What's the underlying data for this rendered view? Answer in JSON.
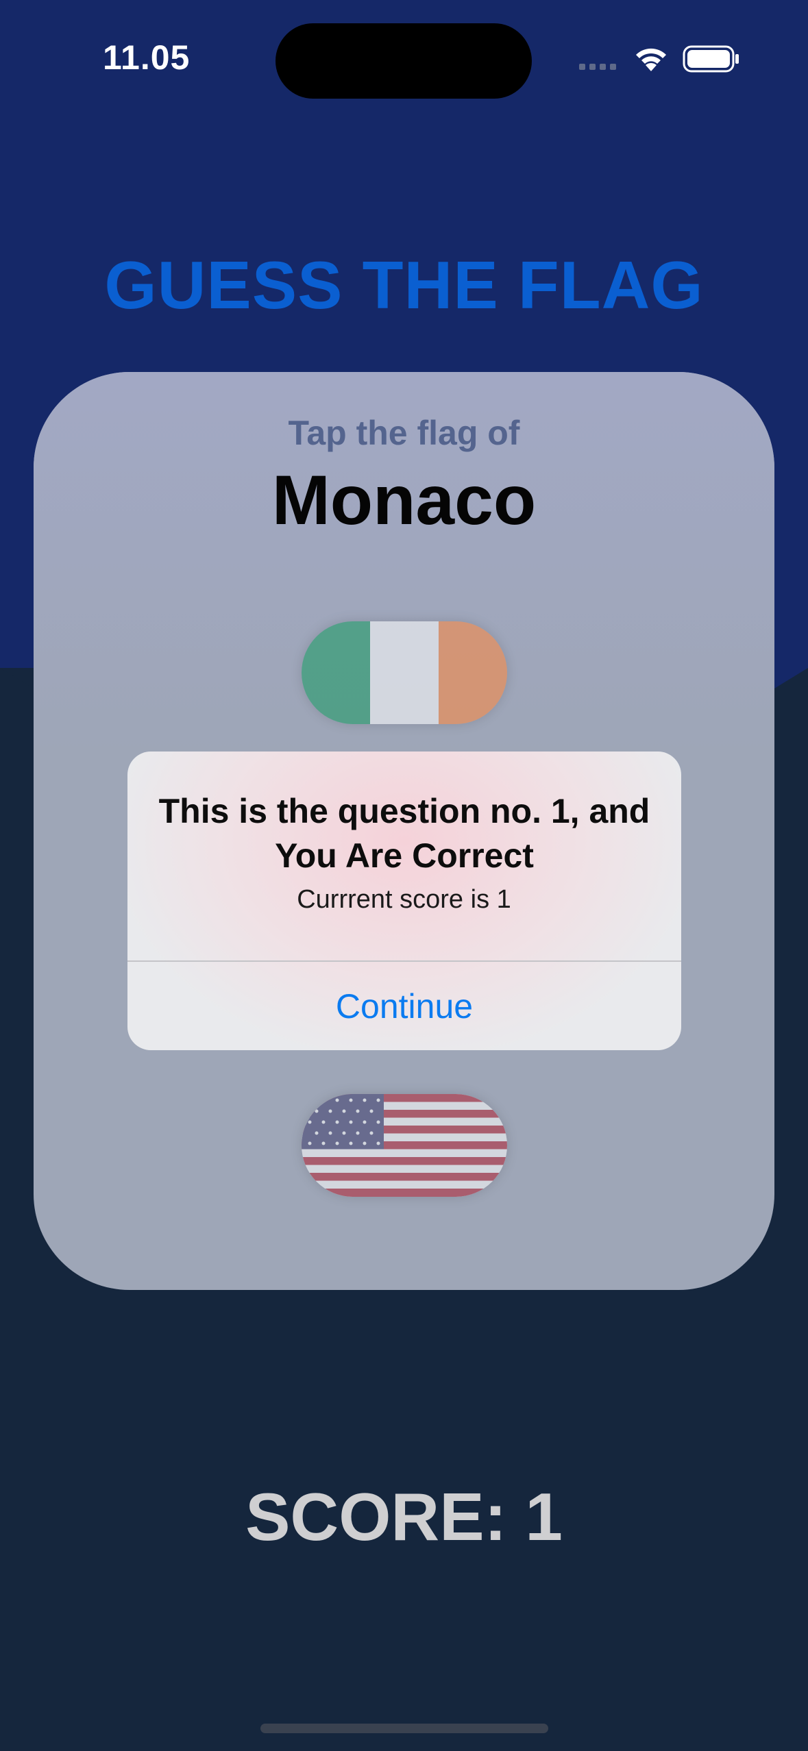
{
  "status_bar": {
    "time": "11.05",
    "icons": [
      "cellular-signal-icon",
      "wifi-icon",
      "battery-icon"
    ]
  },
  "title": "GUESS THE FLAG",
  "card": {
    "prompt": "Tap the flag of",
    "country": "Monaco",
    "flags": [
      {
        "name": "Ireland",
        "colors": [
          "#169b62",
          "#ffffff",
          "#ff883e"
        ]
      },
      {
        "name": "United States",
        "colors": [
          "#b22234",
          "#ffffff",
          "#3c3b6e"
        ]
      }
    ]
  },
  "alert": {
    "title": "This is the question no. 1, and You Are Correct",
    "message": "Currrent score is 1",
    "button": "Continue"
  },
  "score_label": "SCORE: 1",
  "colors": {
    "background_top": "#152868",
    "background_bottom": "#15263d",
    "title": "#0a5fd1",
    "alert_button": "#0b7bf0"
  }
}
